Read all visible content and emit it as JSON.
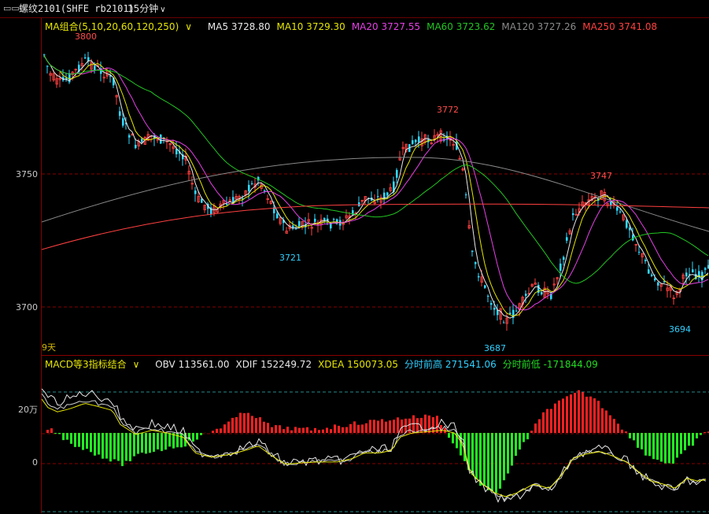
{
  "header": {
    "window_icon": "▭▭",
    "instrument": "螺纹2101(SHFE rb2101)",
    "period": "15分钟",
    "period_caret": "∨"
  },
  "main_legend": {
    "combo_label": "MA组合(5,10,20,60,120,250)",
    "combo_caret": "∨",
    "items": [
      {
        "text": "MA5 3728.80",
        "color": "#e8e8e8"
      },
      {
        "text": "MA10 3729.30",
        "color": "#e6e600"
      },
      {
        "text": "MA20 3727.55",
        "color": "#e640e6"
      },
      {
        "text": "MA60 3723.62",
        "color": "#22c522"
      },
      {
        "text": "MA120 3727.26",
        "color": "#8a8a8a"
      },
      {
        "text": "MA250 3741.08",
        "color": "#ff4040"
      }
    ]
  },
  "price_axis": {
    "labels": [
      "3750",
      "3700"
    ]
  },
  "price_markers": [
    {
      "text": "3800",
      "color": "#ff4a4a"
    },
    {
      "text": "3772",
      "color": "#ff4a4a"
    },
    {
      "text": "3747",
      "color": "#ff4a4a"
    },
    {
      "text": "3721",
      "color": "#30d0ff"
    },
    {
      "text": "3687",
      "color": "#30d0ff"
    },
    {
      "text": "3694",
      "color": "#30d0ff"
    }
  ],
  "days_label": "9天",
  "sub_legend": {
    "combo_label": "MACD等3指标结合",
    "combo_caret": "∨",
    "items": [
      {
        "text": "OBV 113561.00",
        "color": "#e8e8e8"
      },
      {
        "text": "XDIF 152249.72",
        "color": "#e8e8e8"
      },
      {
        "text": "XDEA 150073.05",
        "color": "#e6e600"
      },
      {
        "text": "分时前高 271541.06",
        "color": "#30d0ff"
      },
      {
        "text": "分时前低 -171844.09",
        "color": "#22dd22"
      }
    ]
  },
  "sub_axis": {
    "labels": [
      "20万",
      "0"
    ]
  },
  "colors": {
    "up": "#ff4040",
    "down": "#30d8ff",
    "grid": "#8a0000",
    "hist_up": "#ff2020",
    "hist_down": "#22ee22"
  }
}
